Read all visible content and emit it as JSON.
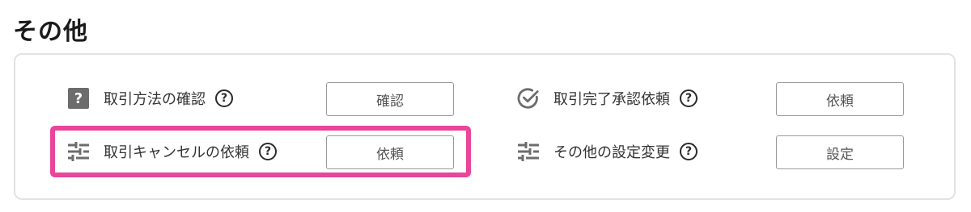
{
  "section": {
    "title": "その他"
  },
  "items": [
    {
      "label": "取引方法の確認",
      "icon": "question-box-icon",
      "button": "確認"
    },
    {
      "label": "取引完了承認依頼",
      "icon": "check-circle-icon",
      "button": "依頼"
    },
    {
      "label": "取引キャンセルの依頼",
      "icon": "sliders-icon",
      "button": "依頼"
    },
    {
      "label": "その他の設定変更",
      "icon": "sliders-icon",
      "button": "設定"
    }
  ],
  "help_glyph": "?",
  "icon_glyph_question": "?",
  "colors": {
    "highlight": "#e8459b",
    "icon_gray": "#6c6c6c",
    "border": "#e2e2e2"
  }
}
